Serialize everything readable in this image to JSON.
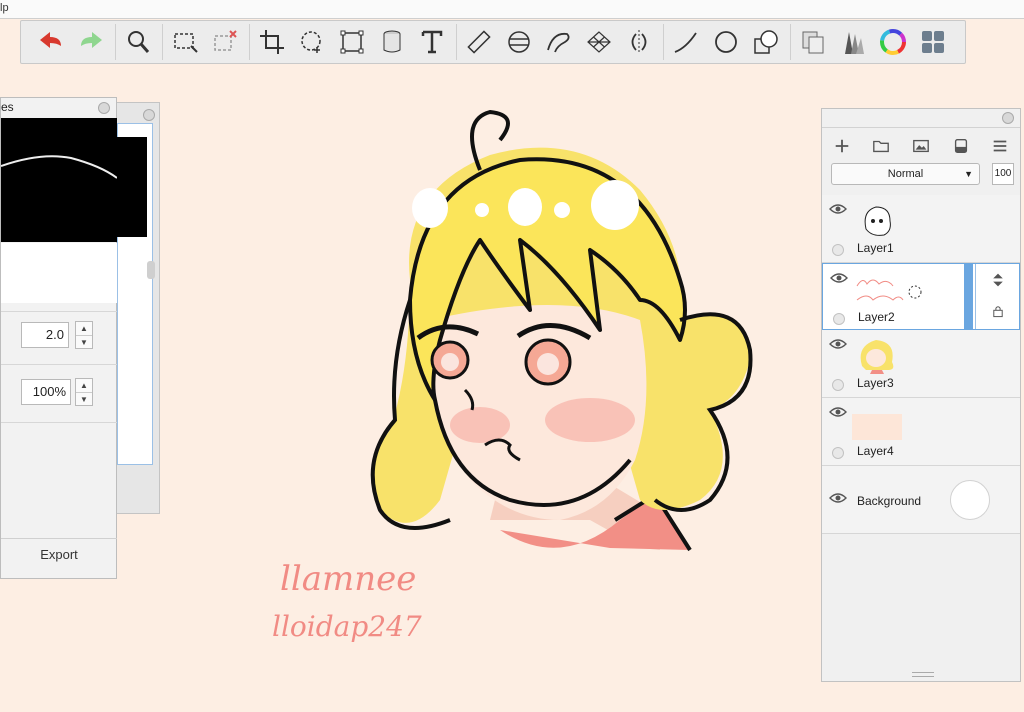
{
  "menubar": {
    "label": "lp"
  },
  "left_panel": {
    "title": "es",
    "field_size": "2.0",
    "field_opacity": "100%",
    "export_label": "Export"
  },
  "layers_panel": {
    "blend_mode": "Normal",
    "opacity": "100",
    "layers": [
      {
        "name": "Layer1"
      },
      {
        "name": "Layer2",
        "selected": true
      },
      {
        "name": "Layer3"
      },
      {
        "name": "Layer4"
      }
    ],
    "background_label": "Background"
  },
  "canvas": {
    "signature_line1": "llamnee",
    "signature_line2": "lloidap247"
  }
}
